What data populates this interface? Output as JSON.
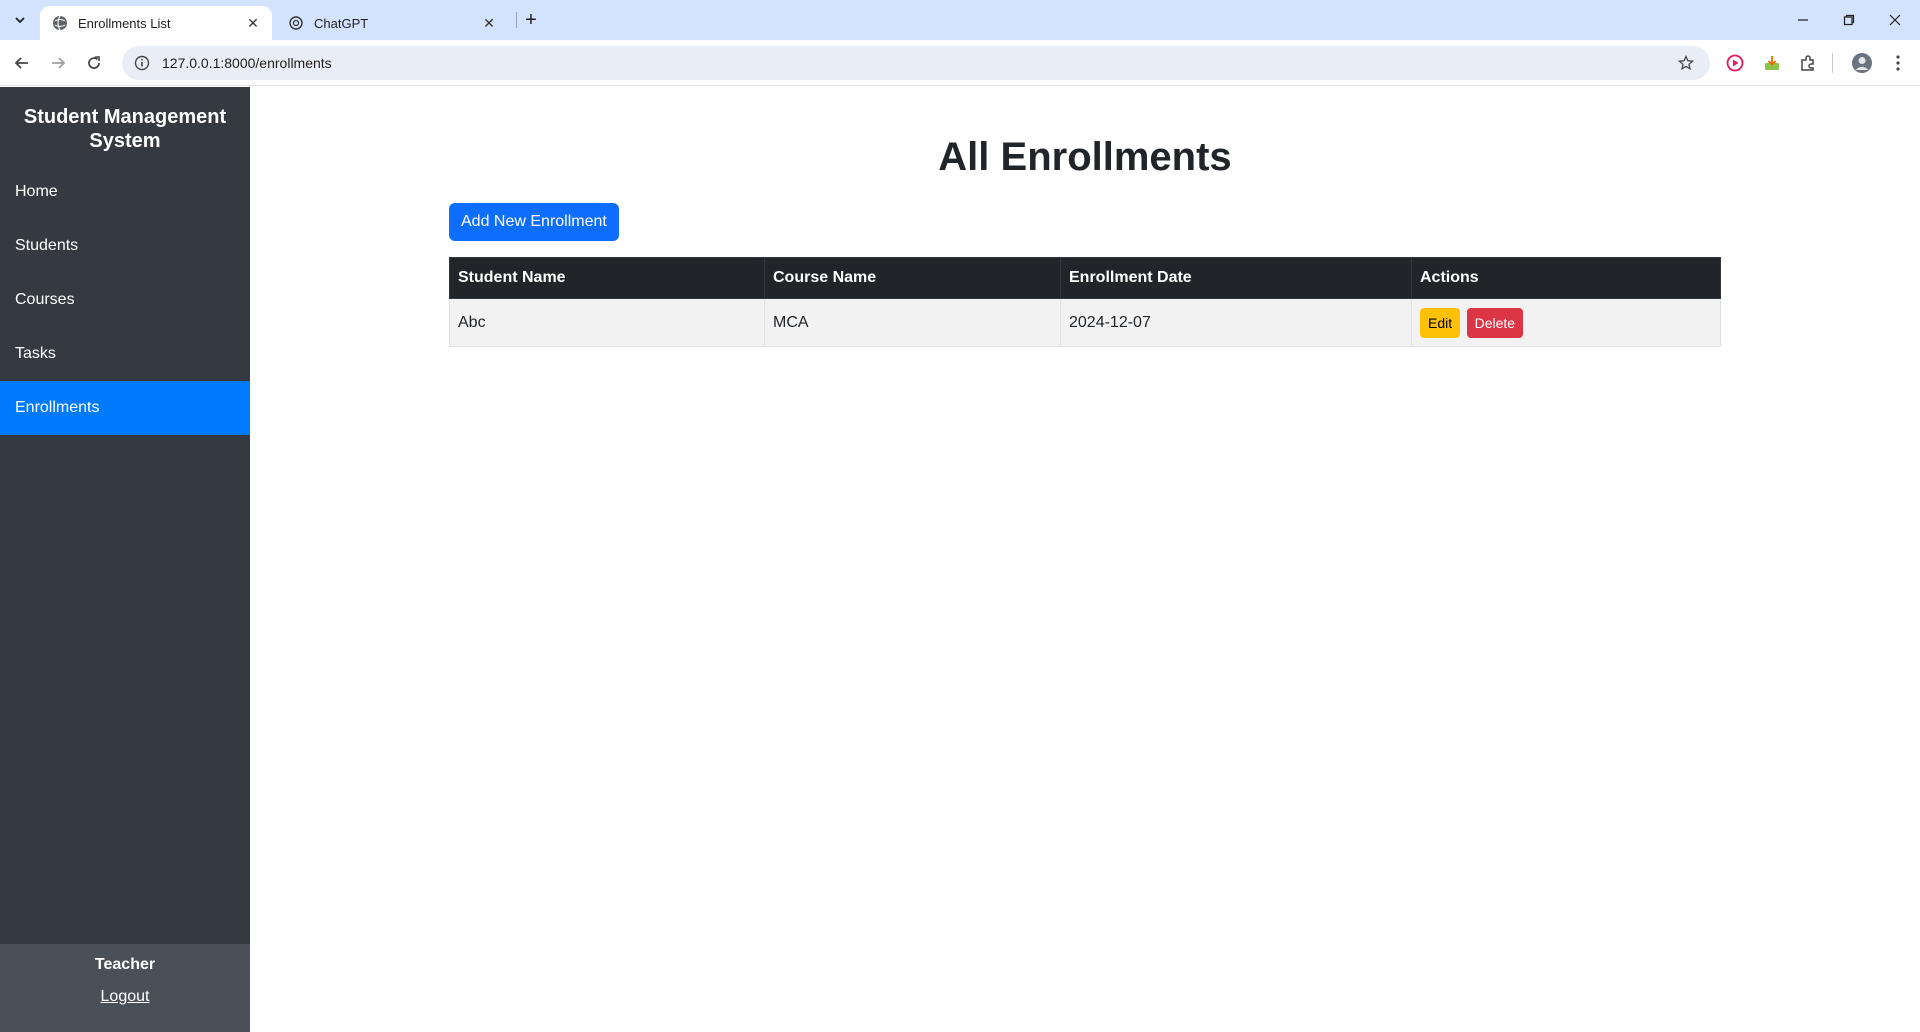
{
  "browser": {
    "tabs": [
      {
        "title": "Enrollments List",
        "active": true
      },
      {
        "title": "ChatGPT",
        "active": false
      }
    ],
    "url": "127.0.0.1:8000/enrollments",
    "new_tab_label": "+"
  },
  "sidebar": {
    "brand": "Student Management System",
    "items": [
      {
        "label": "Home",
        "active": false
      },
      {
        "label": "Students",
        "active": false
      },
      {
        "label": "Courses",
        "active": false
      },
      {
        "label": "Tasks",
        "active": false
      },
      {
        "label": "Enrollments",
        "active": true
      }
    ],
    "role": "Teacher",
    "logout": "Logout"
  },
  "main": {
    "title": "All Enrollments",
    "add_button": "Add New Enrollment",
    "table": {
      "headers": [
        "Student Name",
        "Course Name",
        "Enrollment Date",
        "Actions"
      ],
      "rows": [
        {
          "student": "Abc",
          "course": "MCA",
          "date": "2024-12-07",
          "edit": "Edit",
          "delete": "Delete"
        }
      ]
    }
  },
  "colors": {
    "sidebar_bg": "#343a40",
    "active_nav": "#007bff",
    "primary_button": "#0d6efd",
    "edit_button": "#ffc107",
    "delete_button": "#dc3545",
    "table_header": "#212529"
  }
}
